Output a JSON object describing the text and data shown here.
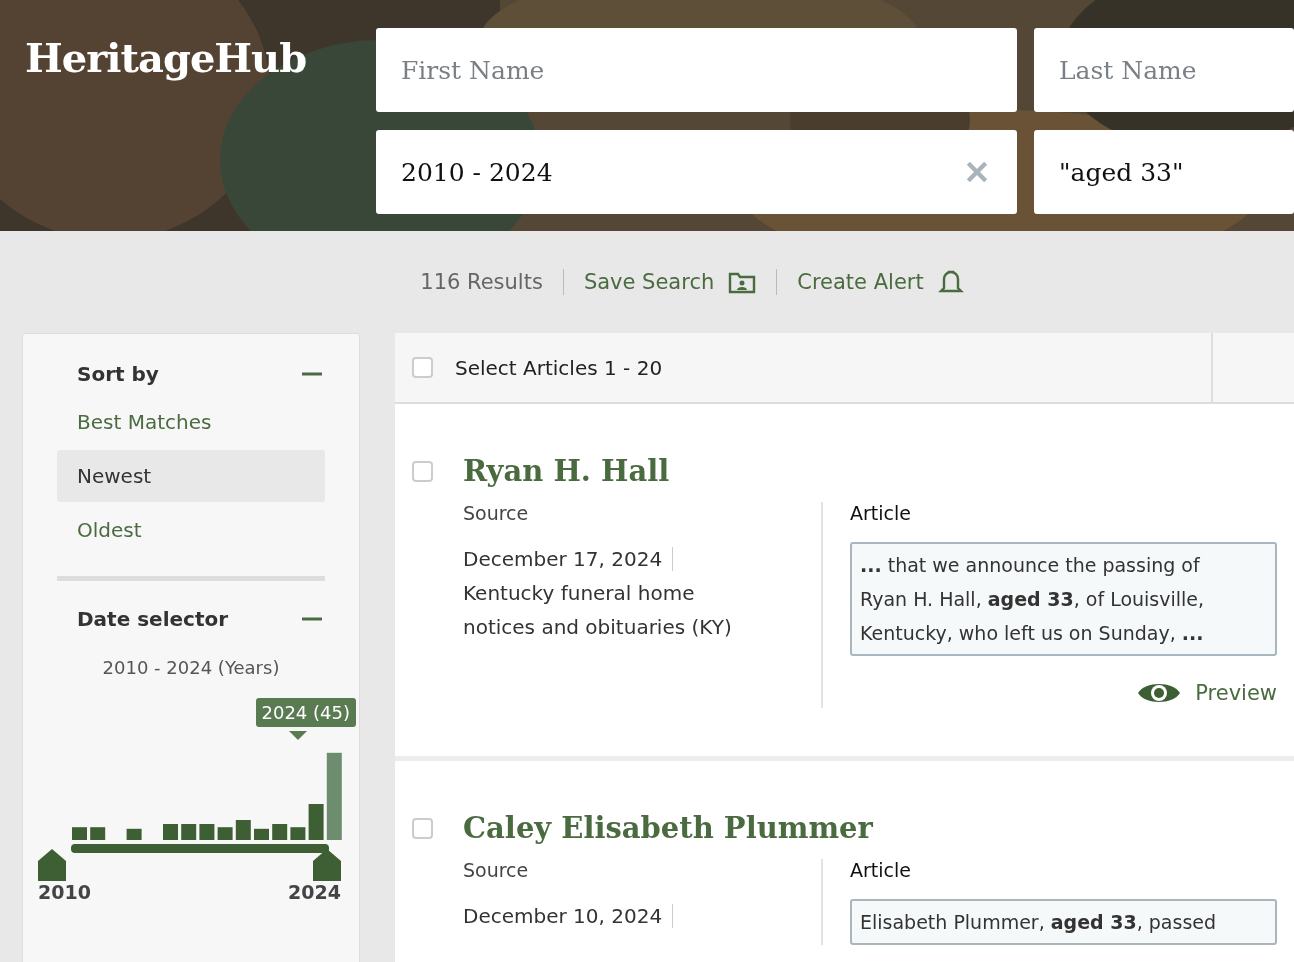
{
  "logo": "HeritageHub",
  "search": {
    "first_name": {
      "placeholder": "First Name"
    },
    "last_name": {
      "placeholder": "Last Name"
    },
    "date_range": {
      "value": "2010 - 2024"
    },
    "keywords": {
      "value": "\"aged 33\""
    }
  },
  "toolbar": {
    "results": "116 Results",
    "save_search": "Save Search",
    "create_alert": "Create Alert"
  },
  "sidebar": {
    "sort": {
      "title": "Sort by",
      "expanded": true,
      "options": [
        {
          "label": "Best Matches",
          "selected": false
        },
        {
          "label": "Newest",
          "selected": true
        },
        {
          "label": "Oldest",
          "selected": false
        }
      ]
    },
    "date": {
      "title": "Date selector",
      "expanded": true,
      "range": "2010 - 2024 (Years)",
      "tooltip": "2024 (45)",
      "start_label": "2010",
      "end_label": "2024"
    }
  },
  "results": {
    "select_all": {
      "label": "Select Articles 1 - 20",
      "checked": false
    },
    "items": [
      {
        "title": "Ryan H. Hall",
        "checked": false,
        "source_label": "Source",
        "date": "December 17, 2024",
        "source": "Kentucky funeral home notices and obituaries (KY)",
        "article_label": "Article",
        "snippet": "**...** that we announce the passing of Ryan H. Hall, **aged 33**, of Louisville, Kentucky, who left us on Sunday, **...**",
        "preview": "Preview"
      },
      {
        "title": "Caley Elisabeth Plummer",
        "checked": false,
        "source_label": "Source",
        "date": "December 10, 2024",
        "article_label": "Article",
        "snippet": "Elisabeth Plummer, **aged 33**, passed"
      }
    ]
  }
}
